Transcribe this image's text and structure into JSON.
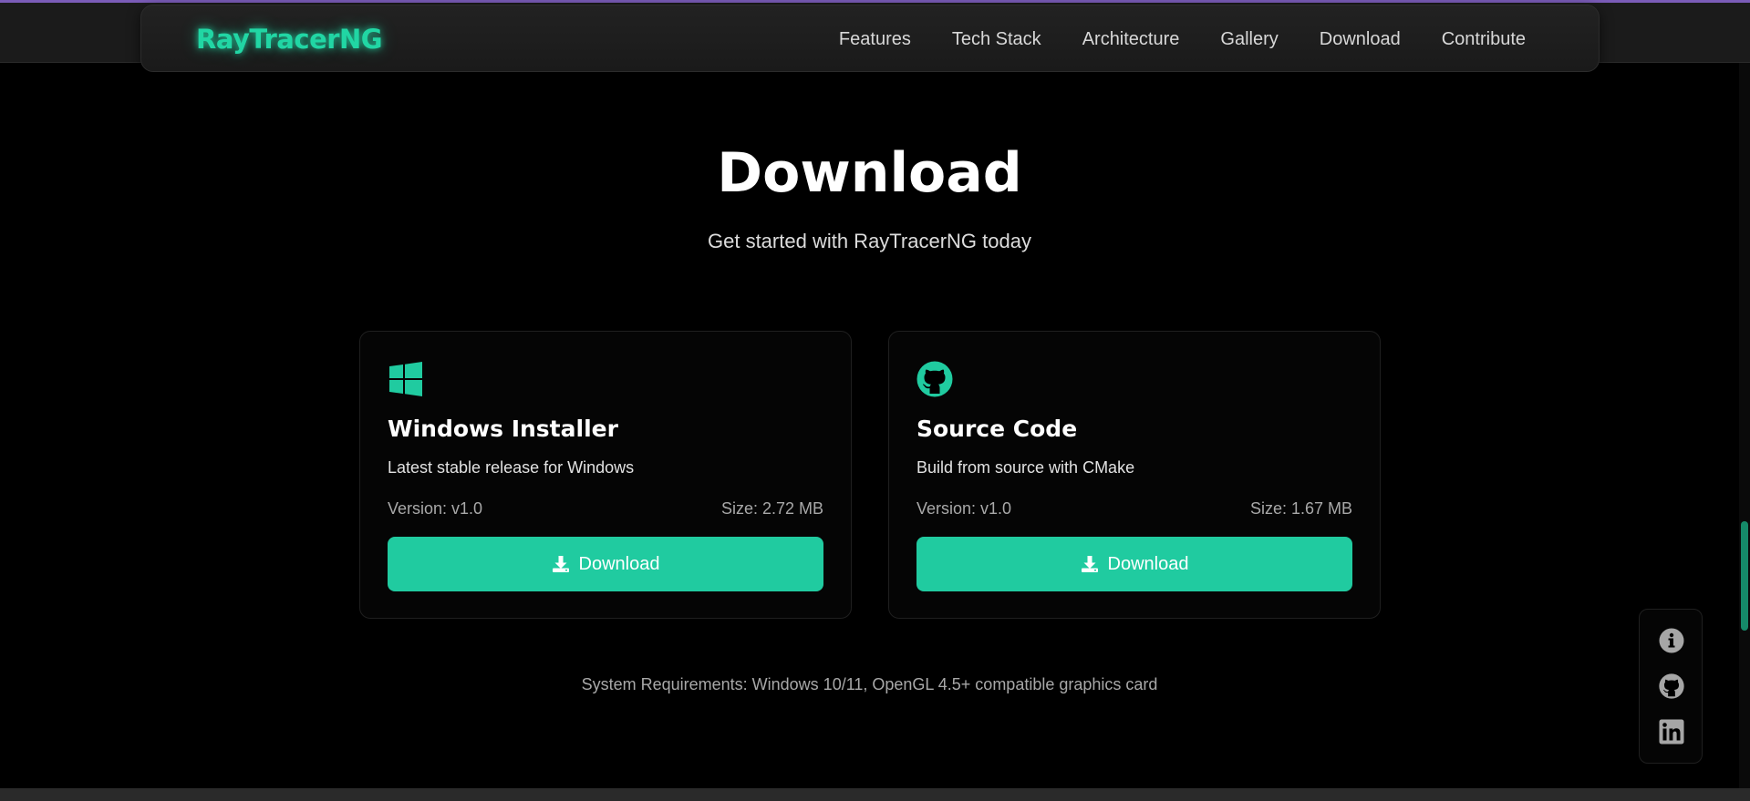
{
  "header": {
    "logo": "RayTracerNG",
    "nav": [
      "Features",
      "Tech Stack",
      "Architecture",
      "Gallery",
      "Download",
      "Contribute"
    ]
  },
  "section": {
    "title": "Download",
    "subtitle": "Get started with RayTracerNG today"
  },
  "cards": [
    {
      "icon": "windows-icon",
      "title": "Windows Installer",
      "description": "Latest stable release for Windows",
      "version": "Version: v1.0",
      "size": "Size: 2.72 MB",
      "button_label": "Download",
      "button_icon": "download-icon"
    },
    {
      "icon": "github-icon",
      "title": "Source Code",
      "description": "Build from source with CMake",
      "version": "Version: v1.0",
      "size": "Size: 1.67 MB",
      "button_label": "Download",
      "button_icon": "download-icon"
    }
  ],
  "requirements": "System Requirements: Windows 10/11, OpenGL 4.5+ compatible graphics card",
  "social": [
    "info-icon",
    "github-icon",
    "linkedin-icon"
  ],
  "colors": {
    "accent": "#20cba0",
    "logo": "#21d6a4",
    "background": "#000000",
    "icon_gray": "#a6a6a6"
  }
}
